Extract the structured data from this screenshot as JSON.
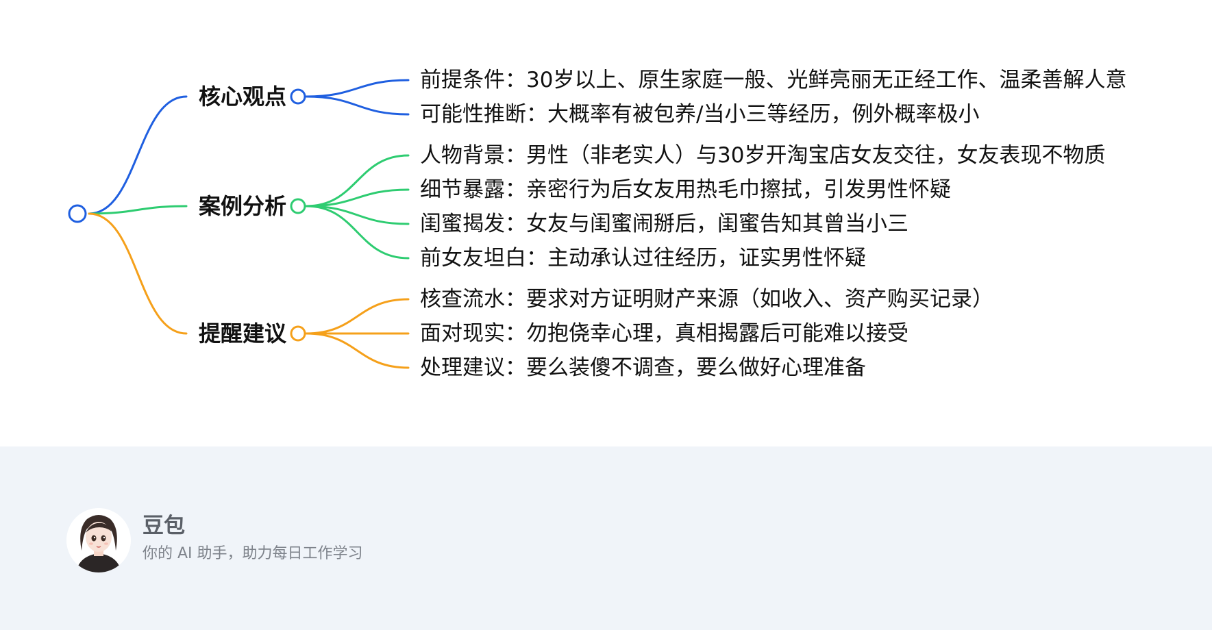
{
  "mindmap": {
    "branches": [
      {
        "label": "核心观点",
        "color": "#1f5fe0",
        "leaves": [
          "前提条件：30岁以上、原生家庭一般、光鲜亮丽无正经工作、温柔善解人意",
          "可能性推断：大概率有被包养/当小三等经历，例外概率极小"
        ]
      },
      {
        "label": "案例分析",
        "color": "#2ecc71",
        "leaves": [
          "人物背景：男性（非老实人）与30岁开淘宝店女友交往，女友表现不物质",
          "细节暴露：亲密行为后女友用热毛巾擦拭，引发男性怀疑",
          "闺蜜揭发：女友与闺蜜闹掰后，闺蜜告知其曾当小三",
          "前女友坦白：主动承认过往经历，证实男性怀疑"
        ]
      },
      {
        "label": "提醒建议",
        "color": "#f5a01a",
        "leaves": [
          "核查流水：要求对方证明财产来源（如收入、资产购买记录）",
          "面对现实：勿抱侥幸心理，真相揭露后可能难以接受",
          "处理建议：要么装傻不调查，要么做好心理准备"
        ]
      }
    ],
    "root_color": "#1f5fe0"
  },
  "footer": {
    "name": "豆包",
    "tagline": "你的 AI 助手，助力每日工作学习"
  }
}
